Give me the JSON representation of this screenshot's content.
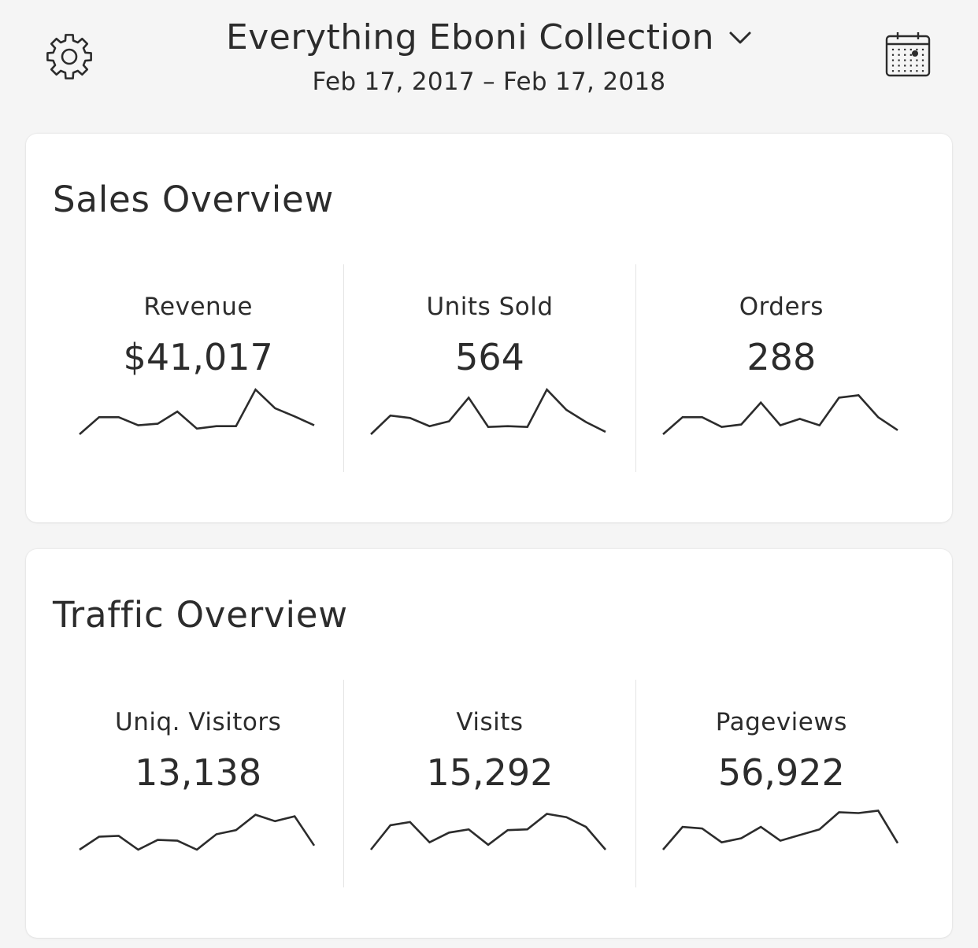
{
  "header": {
    "title": "Everything Eboni Collection",
    "date_range": "Feb 17, 2017 – Feb 17, 2018",
    "icons": {
      "left": "gear-icon",
      "right": "calendar-icon",
      "title_toggle": "chevron-down-icon"
    }
  },
  "sales": {
    "title": "Sales Overview",
    "metrics": [
      {
        "label": "Revenue",
        "value": "$41,017"
      },
      {
        "label": "Units Sold",
        "value": "564"
      },
      {
        "label": "Orders",
        "value": "288"
      }
    ]
  },
  "traffic": {
    "title": "Traffic Overview",
    "metrics": [
      {
        "label": "Uniq. Visitors",
        "value": "13,138"
      },
      {
        "label": "Visits",
        "value": "15,292"
      },
      {
        "label": "Pageviews",
        "value": "56,922"
      }
    ]
  },
  "chart_data": [
    {
      "type": "line",
      "name": "Revenue",
      "values": [
        0,
        21,
        21,
        11,
        13,
        28,
        7,
        10,
        10,
        55,
        32,
        22,
        11
      ]
    },
    {
      "type": "line",
      "name": "Units Sold",
      "values": [
        0,
        23,
        20,
        10,
        16,
        45,
        9,
        10,
        9,
        55,
        30,
        15,
        3
      ]
    },
    {
      "type": "line",
      "name": "Orders",
      "values": [
        0,
        21,
        21,
        9,
        12,
        39,
        11,
        19,
        11,
        45,
        48,
        21,
        5
      ]
    },
    {
      "type": "line",
      "name": "Uniq. Visitors",
      "values": [
        0,
        16,
        17,
        0,
        12,
        11,
        0,
        19,
        24,
        43,
        35,
        41,
        5
      ]
    },
    {
      "type": "line",
      "name": "Visits",
      "values": [
        0,
        30,
        34,
        9,
        21,
        25,
        6,
        24,
        25,
        44,
        40,
        28,
        0
      ]
    },
    {
      "type": "line",
      "name": "Pageviews",
      "values": [
        0,
        28,
        26,
        9,
        14,
        28,
        11,
        18,
        25,
        46,
        45,
        48,
        8
      ]
    }
  ],
  "colors": {
    "background": "#f5f5f5",
    "card": "#ffffff",
    "text": "#2c2c2c",
    "line": "#2c2c2c",
    "divider": "#e4e4e4"
  }
}
